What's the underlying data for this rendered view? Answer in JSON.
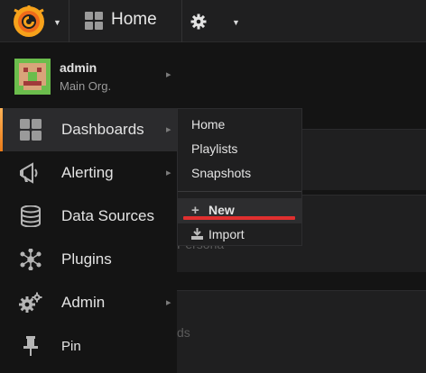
{
  "navbar": {
    "home_label": "Home"
  },
  "background": {
    "partial_text_1": "Persona",
    "partial_text_2": "ds"
  },
  "profile": {
    "name": "admin",
    "org": "Main Org."
  },
  "sidemenu": {
    "items": [
      {
        "label": "Dashboards",
        "icon": "dashboards-grid-icon",
        "active": true,
        "has_submenu": true
      },
      {
        "label": "Alerting",
        "icon": "megaphone-icon",
        "active": false,
        "has_submenu": true
      },
      {
        "label": "Data Sources",
        "icon": "database-icon",
        "active": false,
        "has_submenu": false
      },
      {
        "label": "Plugins",
        "icon": "plugins-icon",
        "active": false,
        "has_submenu": false
      },
      {
        "label": "Admin",
        "icon": "cogs-icon",
        "active": false,
        "has_submenu": true
      },
      {
        "label": "Pin",
        "icon": "pin-icon",
        "active": false,
        "has_submenu": false
      }
    ]
  },
  "dashboards_menu": {
    "links": [
      "Home",
      "Playlists",
      "Snapshots"
    ],
    "new_label": "New",
    "import_label": "Import"
  },
  "colors": {
    "accent_orange": "#eb7b18",
    "highlight_red": "#e02f2f",
    "sidemenu_bg": "#141414",
    "active_item_bg": "#2b2b2d"
  }
}
